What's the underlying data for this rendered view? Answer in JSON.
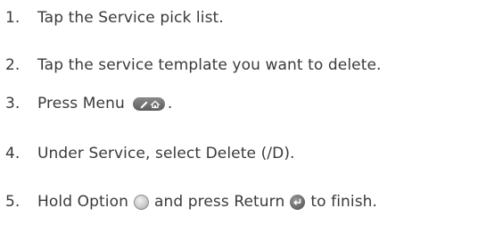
{
  "steps": [
    {
      "number": "1.",
      "text": "Tap the Service pick list."
    },
    {
      "number": "2.",
      "text": "Tap the service template you want to delete."
    },
    {
      "number": "3.",
      "text_before": "Press Menu",
      "text_after": ".",
      "icon": "menu-key-icon"
    },
    {
      "number": "4.",
      "text": "Under Service, select Delete (/D)."
    },
    {
      "number": "5.",
      "text_part1": "Hold Option",
      "text_part2": "and press Return",
      "text_part3": "to finish.",
      "icons": [
        "option-key-icon",
        "return-key-icon"
      ]
    }
  ],
  "colors": {
    "text": "#3a3a3a",
    "icon_dark": "#5d5d5d",
    "icon_light": "#d0d0d0"
  }
}
